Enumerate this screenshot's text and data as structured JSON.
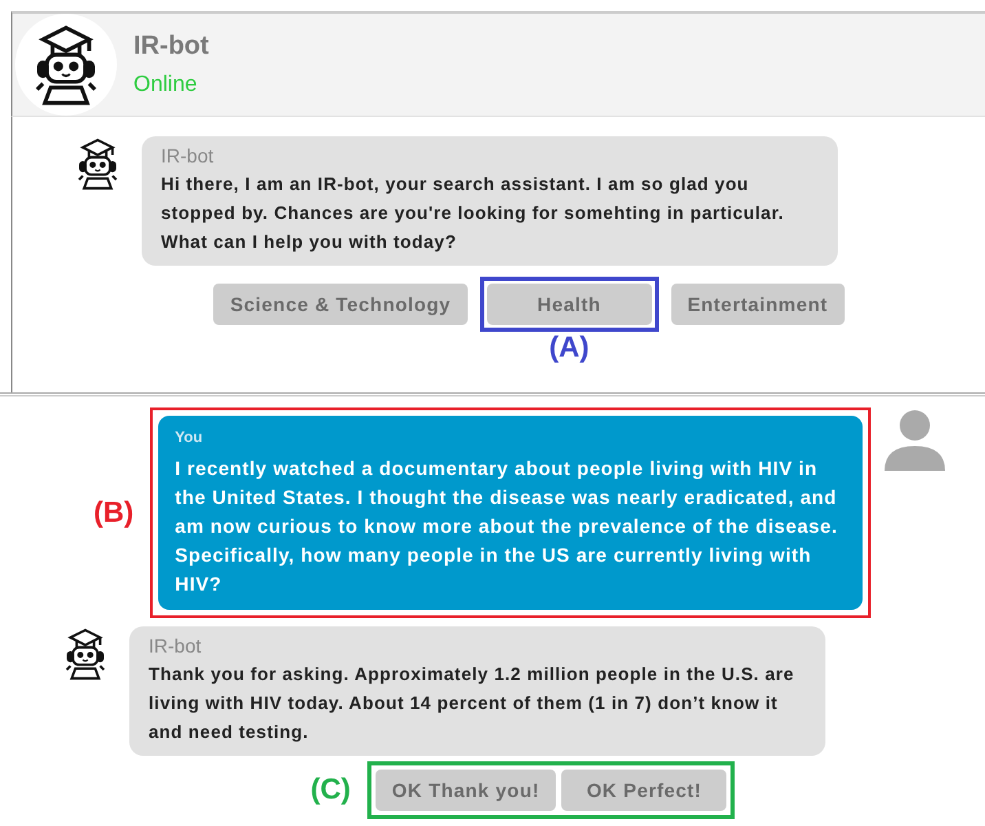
{
  "header": {
    "name": "IR-bot",
    "status": "Online"
  },
  "messages": [
    {
      "kind": "bot",
      "sender": "IR-bot",
      "text": "Hi there, I am an IR-bot, your search assistant. I am so glad you stopped by. Chances are you're looking for somehting in particular. What can I help you with today?",
      "options": [
        {
          "label": "Science & Technology",
          "boxed": false
        },
        {
          "label": "Health",
          "boxed": true
        },
        {
          "label": "Entertainment",
          "boxed": false
        }
      ],
      "callout": {
        "label": "(A)",
        "color": "#3f47cc",
        "kind": "option"
      }
    },
    {
      "kind": "user",
      "sender": "You",
      "text": "I recently watched a documentary about people living with HIV in the United States. I thought the disease was nearly eradicated, and am now curious to know more about the prevalence of the disease. Specifically, how many people in the US are currently living with HIV?",
      "callout": {
        "label": "(B)",
        "color": "#e8202a",
        "kind": "bubble"
      }
    },
    {
      "kind": "bot",
      "sender": "IR-bot",
      "text": "Thank you for asking. Approximately 1.2 million people in the U.S. are living with HIV today. About 14 percent of them (1 in 7) don’t know it and need testing.",
      "options": [
        {
          "label": "OK Thank you!",
          "boxed": false
        },
        {
          "label": "OK Perfect!",
          "boxed": false
        }
      ],
      "callout": {
        "label": "(C)",
        "color": "#22b14c",
        "kind": "options"
      }
    }
  ]
}
